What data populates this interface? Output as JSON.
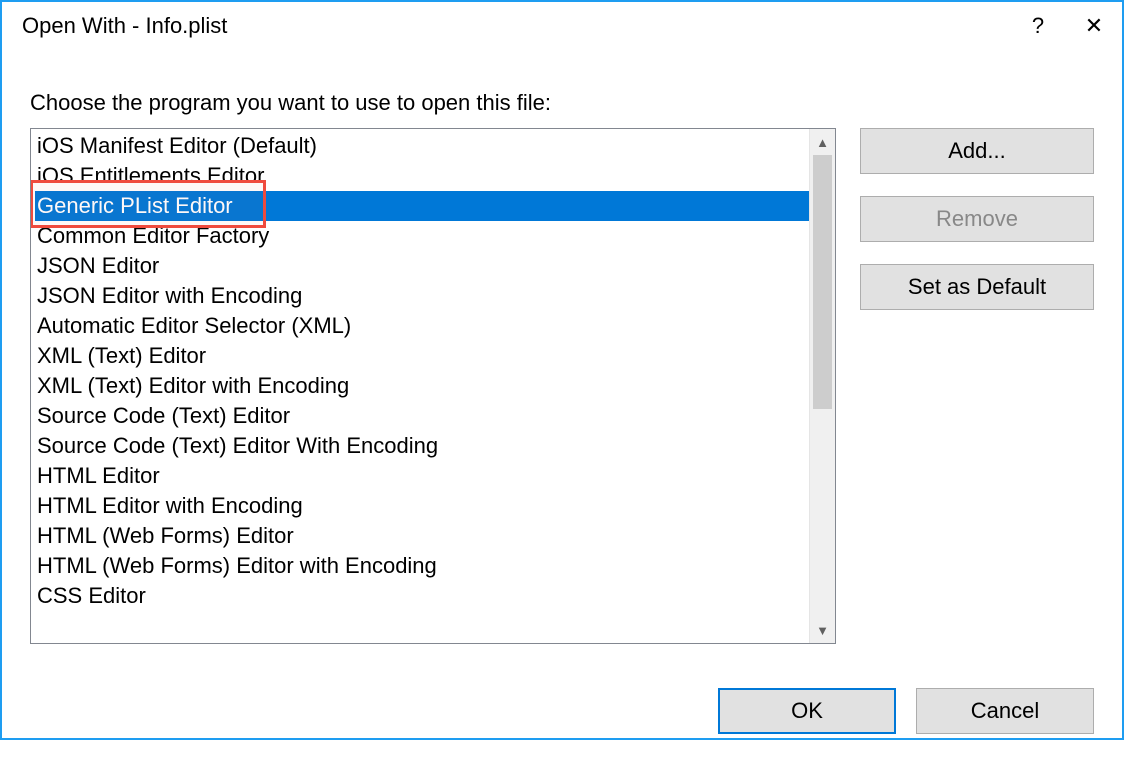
{
  "window": {
    "title": "Open With - Info.plist",
    "help_text": "?",
    "close_text": "✕"
  },
  "instruction": "Choose the program you want to use to open this file:",
  "list_items": [
    {
      "label": "iOS Manifest Editor (Default)",
      "selected": false,
      "highlighted": false
    },
    {
      "label": "iOS Entitlements Editor",
      "selected": false,
      "highlighted": false
    },
    {
      "label": "Generic PList Editor",
      "selected": true,
      "highlighted": true
    },
    {
      "label": "Common Editor Factory",
      "selected": false,
      "highlighted": false
    },
    {
      "label": "JSON Editor",
      "selected": false,
      "highlighted": false
    },
    {
      "label": "JSON Editor with Encoding",
      "selected": false,
      "highlighted": false
    },
    {
      "label": "Automatic Editor Selector (XML)",
      "selected": false,
      "highlighted": false
    },
    {
      "label": "XML (Text) Editor",
      "selected": false,
      "highlighted": false
    },
    {
      "label": "XML (Text) Editor with Encoding",
      "selected": false,
      "highlighted": false
    },
    {
      "label": "Source Code (Text) Editor",
      "selected": false,
      "highlighted": false
    },
    {
      "label": "Source Code (Text) Editor With Encoding",
      "selected": false,
      "highlighted": false
    },
    {
      "label": "HTML Editor",
      "selected": false,
      "highlighted": false
    },
    {
      "label": "HTML Editor with Encoding",
      "selected": false,
      "highlighted": false
    },
    {
      "label": "HTML (Web Forms) Editor",
      "selected": false,
      "highlighted": false
    },
    {
      "label": "HTML (Web Forms) Editor with Encoding",
      "selected": false,
      "highlighted": false
    },
    {
      "label": "CSS Editor",
      "selected": false,
      "highlighted": false
    }
  ],
  "side_buttons": {
    "add": "Add...",
    "remove": "Remove",
    "set_default": "Set as Default"
  },
  "footer": {
    "ok": "OK",
    "cancel": "Cancel"
  },
  "scroll": {
    "up_glyph": "▲",
    "down_glyph": "▼"
  }
}
